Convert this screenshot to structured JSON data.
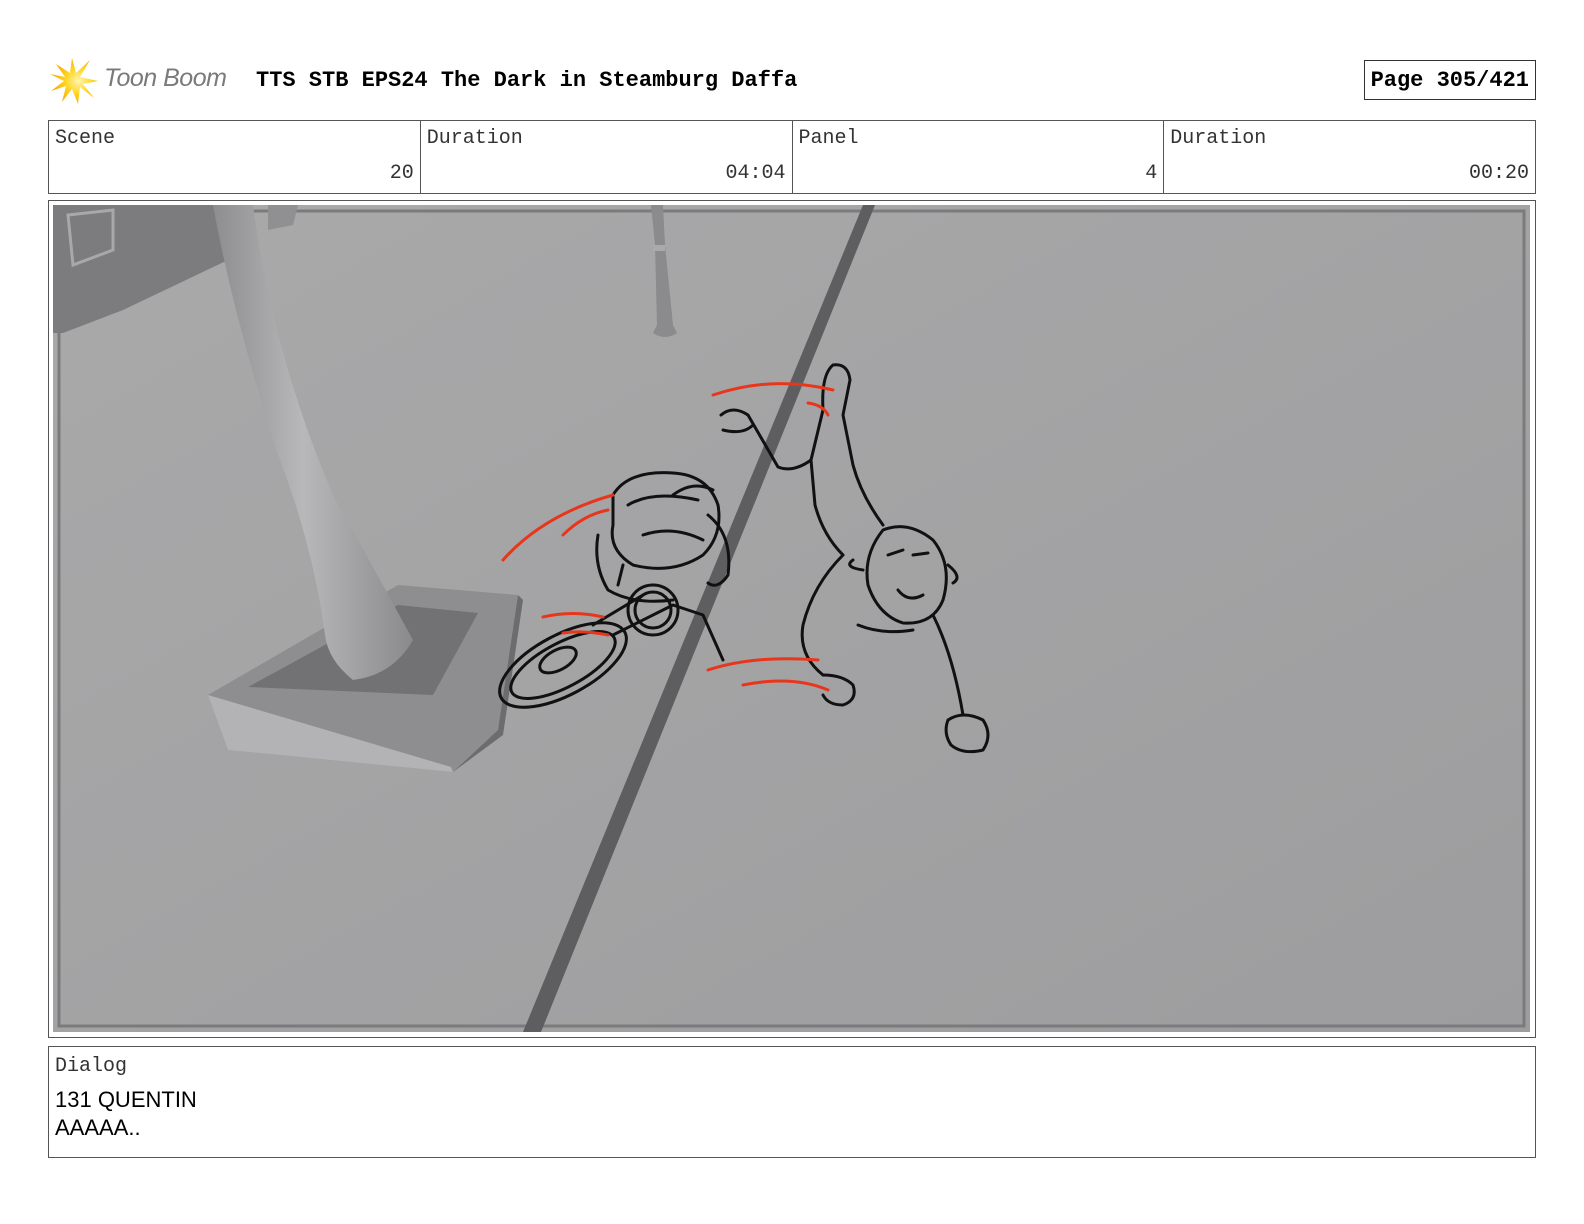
{
  "header": {
    "logo_text": "Toon Boom",
    "title": "TTS STB EPS24 The Dark in Steamburg Daffa",
    "page_label": "Page 305/421"
  },
  "info": {
    "scene_label": "Scene",
    "scene_value": "20",
    "scene_duration_label": "Duration",
    "scene_duration_value": "04:04",
    "panel_label": "Panel",
    "panel_value": "4",
    "panel_duration_label": "Duration",
    "panel_duration_value": "00:20"
  },
  "panel": {
    "icons": [
      "toon-boom-logo-icon"
    ],
    "colors": {
      "ground": "#a3a3a5",
      "sketch_line": "#111111",
      "action_line": "#e8361c"
    }
  },
  "dialog": {
    "label": "Dialog",
    "lines": [
      "131 QUENTIN",
      "AAAAA.."
    ]
  }
}
